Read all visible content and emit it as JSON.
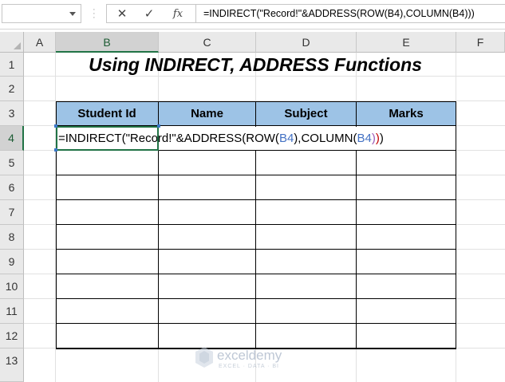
{
  "formula_bar": {
    "name_box": "",
    "cancel_icon": "✕",
    "enter_icon": "✓",
    "fx_label": "fx",
    "formula": "=INDIRECT(\"Record!\"&ADDRESS(ROW(B4),COLUMN(B4)))"
  },
  "columns": [
    "A",
    "B",
    "C",
    "D",
    "E",
    "F"
  ],
  "rows": [
    "1",
    "2",
    "3",
    "4",
    "5",
    "6",
    "7",
    "8",
    "9",
    "10",
    "11",
    "12",
    "13"
  ],
  "title": "Using INDIRECT, ADDRESS Functions",
  "table": {
    "headers": [
      "Student Id",
      "Name",
      "Subject",
      "Marks"
    ]
  },
  "edit": {
    "p1": "=INDIRECT(\"Record!\"&ADDRESS(ROW(",
    "r1": "B4",
    "p2": "),COLUMN(",
    "r2": "B4",
    "p3": ")",
    "p4": ")",
    "p5": ")"
  },
  "watermark": {
    "name": "exceldemy",
    "tagline": "EXCEL · DATA · BI"
  },
  "colors": {
    "header_fill": "#9dc3e6",
    "active_border": "#217346",
    "reference_blue": "#4472c4"
  }
}
